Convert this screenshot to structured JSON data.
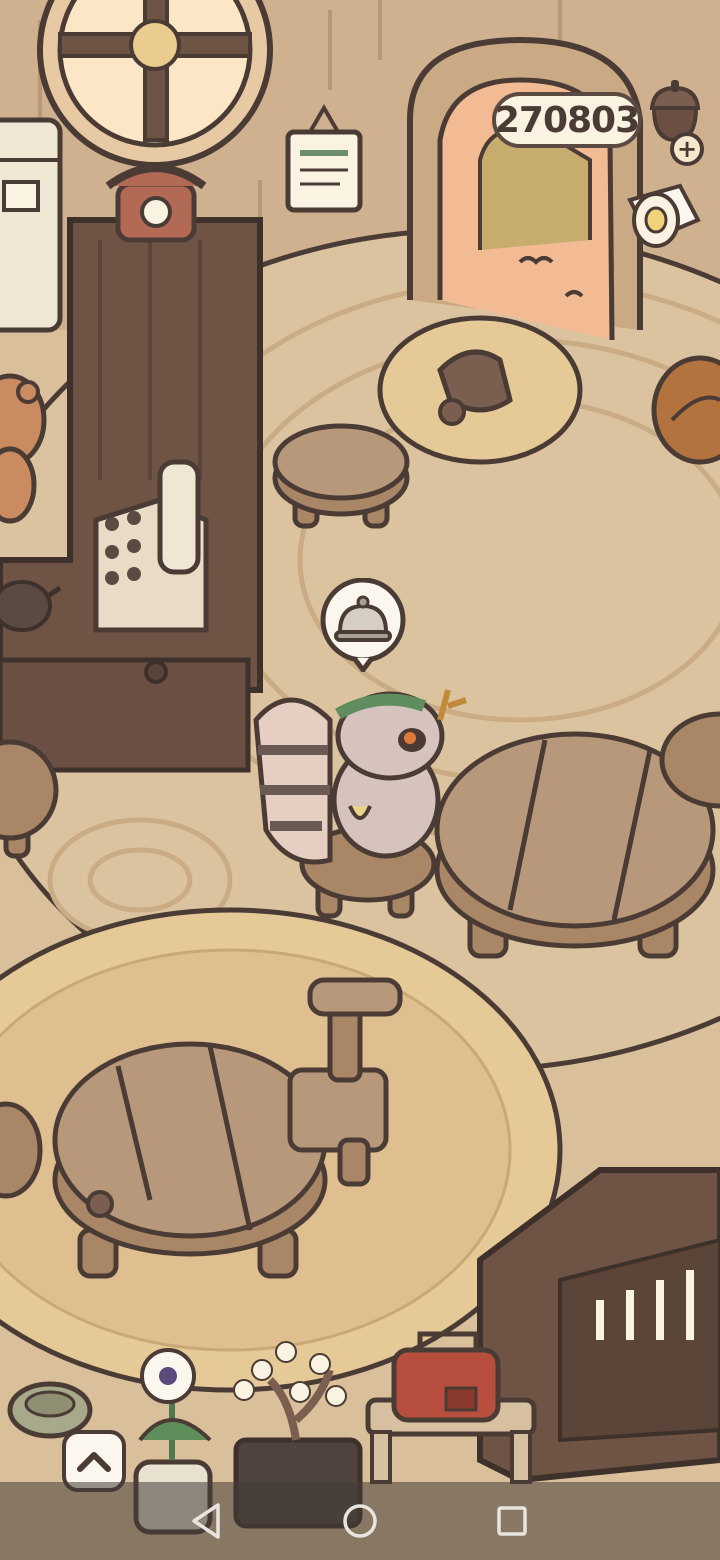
{
  "hud": {
    "coins": "270803",
    "coin_icon": "acorn-icon",
    "plus_icon": "plus-icon",
    "gift_icon": "toilet-paper-icon"
  },
  "scene": {
    "customer_request_icon": "service-bell-icon",
    "customer": "raccoon"
  },
  "controls": {
    "expand_icon": "chevron-up-icon"
  },
  "navbar": {
    "back_icon": "triangle-back-icon",
    "home_icon": "circle-home-icon",
    "recents_icon": "square-recents-icon"
  },
  "colors": {
    "floor": "#d9bf9a",
    "outline": "#4a3b35",
    "wood": "#a88666",
    "rug": "#e5c996"
  }
}
